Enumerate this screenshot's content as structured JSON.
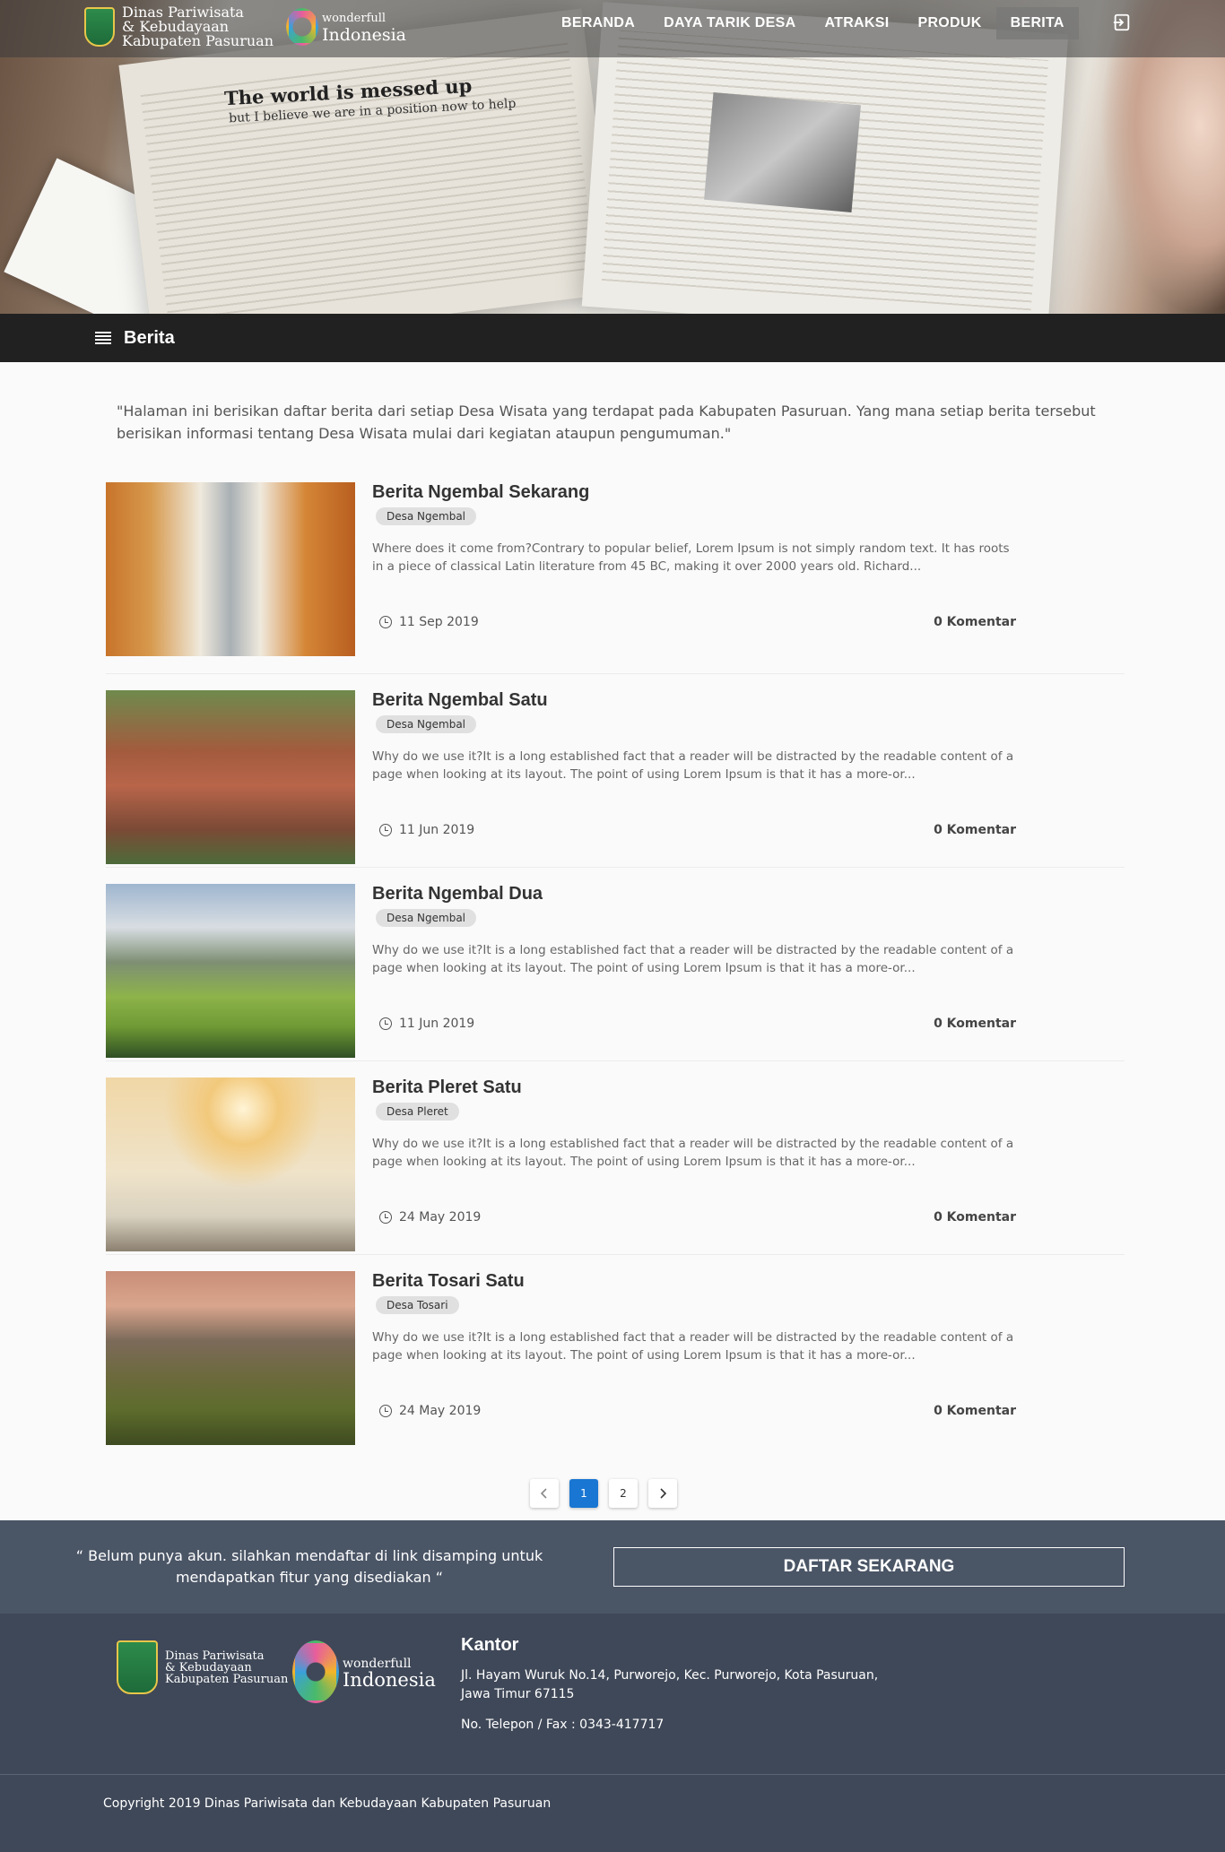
{
  "header": {
    "brand_line1": "Dinas Pariwisata",
    "brand_line2": "& Kebudayaan",
    "brand_line3": "Kabupaten Pasuruan",
    "wi_small": "wonderfull",
    "wi_big": "Indonesia",
    "nav": [
      "BERANDA",
      "DAYA TARIK DESA",
      "ATRAKSI",
      "PRODUK",
      "BERITA"
    ],
    "active_nav": "BERITA",
    "hero_headline": "The world is messed up",
    "hero_subline": "but I believe we are in a position now to help"
  },
  "section": {
    "title": "Berita"
  },
  "intro": "\"Halaman ini berisikan daftar berita dari setiap Desa Wisata yang terdapat pada Kabupaten Pasuruan. Yang mana setiap berita tersebut berisikan informasi tentang Desa Wisata mulai dari kegiatan ataupun pengumuman.\"",
  "news": [
    {
      "title": "Berita Ngembal Sekarang",
      "tag": "Desa Ngembal",
      "excerpt": "Where does it come from?Contrary to popular belief, Lorem Ipsum is not simply random text. It has roots in a piece of classical Latin literature from 45 BC, making it over 2000 years old. Richard...",
      "date": "11 Sep 2019",
      "comments": "0 Komentar"
    },
    {
      "title": "Berita Ngembal Satu",
      "tag": "Desa Ngembal",
      "excerpt": "Why do we use it?It is a long established fact that a reader will be distracted by the readable content of a page when looking at its layout. The point of using Lorem Ipsum is that it has a more-or...",
      "date": "11 Jun 2019",
      "comments": "0 Komentar"
    },
    {
      "title": "Berita Ngembal Dua",
      "tag": "Desa Ngembal",
      "excerpt": "Why do we use it?It is a long established fact that a reader will be distracted by the readable content of a page when looking at its layout. The point of using Lorem Ipsum is that it has a more-or...",
      "date": "11 Jun 2019",
      "comments": "0 Komentar"
    },
    {
      "title": "Berita Pleret Satu",
      "tag": "Desa Pleret",
      "excerpt": "Why do we use it?It is a long established fact that a reader will be distracted by the readable content of a page when looking at its layout. The point of using Lorem Ipsum is that it has a more-or...",
      "date": "24 May 2019",
      "comments": "0 Komentar"
    },
    {
      "title": "Berita Tosari Satu",
      "tag": "Desa Tosari",
      "excerpt": "Why do we use it?It is a long established fact that a reader will be distracted by the readable content of a page when looking at its layout. The point of using Lorem Ipsum is that it has a more-or...",
      "date": "24 May 2019",
      "comments": "0 Komentar"
    }
  ],
  "pagination": {
    "pages": [
      "1",
      "2"
    ],
    "current": "1",
    "prev_icon": "chevron-left",
    "next_icon": "chevron-right"
  },
  "cta": {
    "text": "“ Belum punya akun. silahkan mendaftar di link disamping untuk mendapatkan fitur yang disediakan “",
    "button": "DAFTAR SEKARANG"
  },
  "footer": {
    "office_title": "Kantor",
    "address": "Jl. Hayam Wuruk No.14, Purworejo, Kec. Purworejo, Kota Pasuruan, Jawa Timur 67115",
    "phone": "No. Telepon / Fax : 0343-417717",
    "copyright": "Copyright 2019 Dinas Pariwisata dan Kebudayaan Kabupaten Pasuruan"
  },
  "colors": {
    "accent": "#1976d2",
    "section_bar": "#212121",
    "cta_bg": "#4a5566",
    "footer_bg": "#3f4858"
  }
}
